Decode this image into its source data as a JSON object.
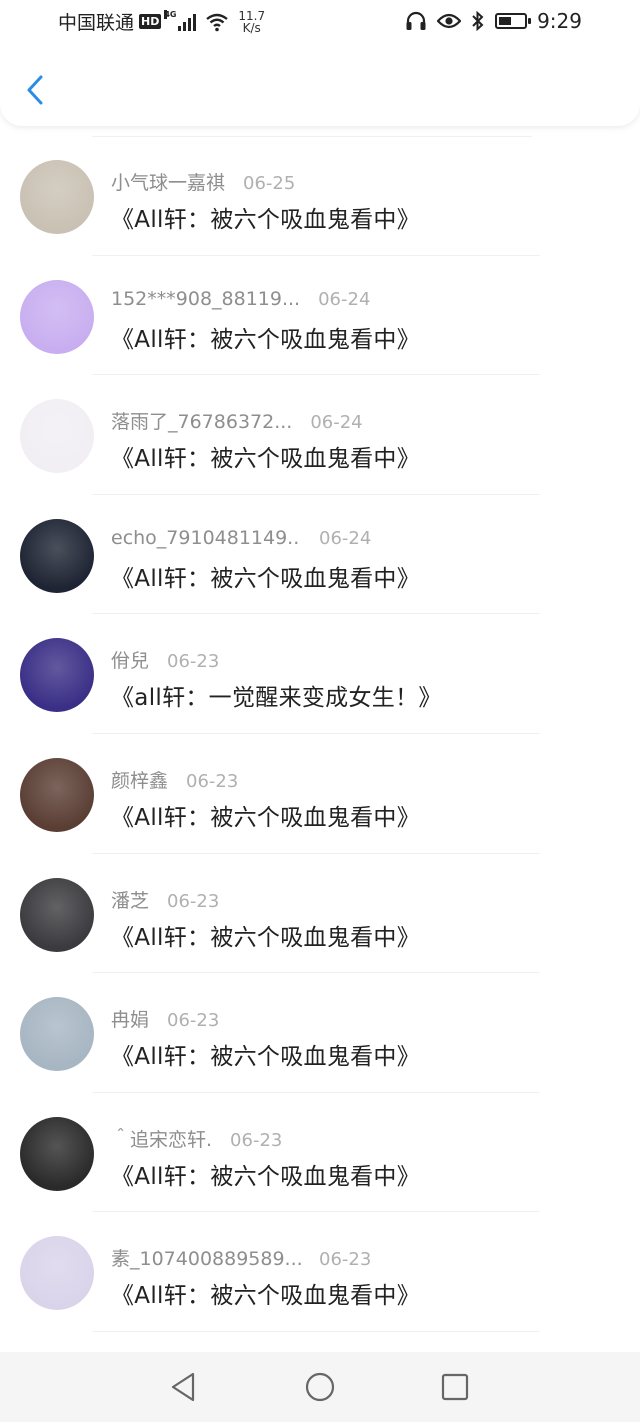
{
  "status_bar": {
    "carrier": "中国联通",
    "hd": "HD",
    "network": "4G",
    "speed_value": "11.7",
    "speed_unit": "K/s",
    "time": "9:29",
    "battery_level": 0.5
  },
  "header": {
    "back_icon": "chevron-left-icon"
  },
  "messages": [
    {
      "name": "小气球一嘉祺",
      "date": "06-25",
      "title": "《All轩：被六个吸血鬼看中》",
      "avatar_color": "#c9c1b3"
    },
    {
      "name": "152***908_88119...",
      "date": "06-24",
      "title": "《All轩：被六个吸血鬼看中》",
      "avatar_color": "#c8aef0"
    },
    {
      "name": "落雨了_76786372...",
      "date": "06-24",
      "title": "《All轩：被六个吸血鬼看中》",
      "avatar_color": "#f1eef4"
    },
    {
      "name": "echo_7910481149...",
      "date": "06-24",
      "title": "《All轩：被六个吸血鬼看中》",
      "avatar_color": "#1e2433"
    },
    {
      "name": "佾兒",
      "date": "06-23",
      "title": "《all轩：一觉醒来变成女生！》",
      "avatar_color": "#3a2f86"
    },
    {
      "name": "颜梓鑫",
      "date": "06-23",
      "title": "《All轩：被六个吸血鬼看中》",
      "avatar_color": "#5a3e34"
    },
    {
      "name": "潘芝",
      "date": "06-23",
      "title": "《All轩：被六个吸血鬼看中》",
      "avatar_color": "#3b3b3f"
    },
    {
      "name": "冉娟",
      "date": "06-23",
      "title": "《All轩：被六个吸血鬼看中》",
      "avatar_color": "#a7b6c3"
    },
    {
      "name": "＾追宋恋轩.",
      "date": "06-23",
      "title": "《All轩：被六个吸血鬼看中》",
      "avatar_color": "#2a2a2a"
    },
    {
      "name": "素_107400889589...",
      "date": "06-23",
      "title": "《All轩：被六个吸血鬼看中》",
      "avatar_color": "#d9d4ea"
    }
  ],
  "nav": {
    "back": "triangle-back-icon",
    "home": "circle-home-icon",
    "recents": "square-recents-icon"
  }
}
